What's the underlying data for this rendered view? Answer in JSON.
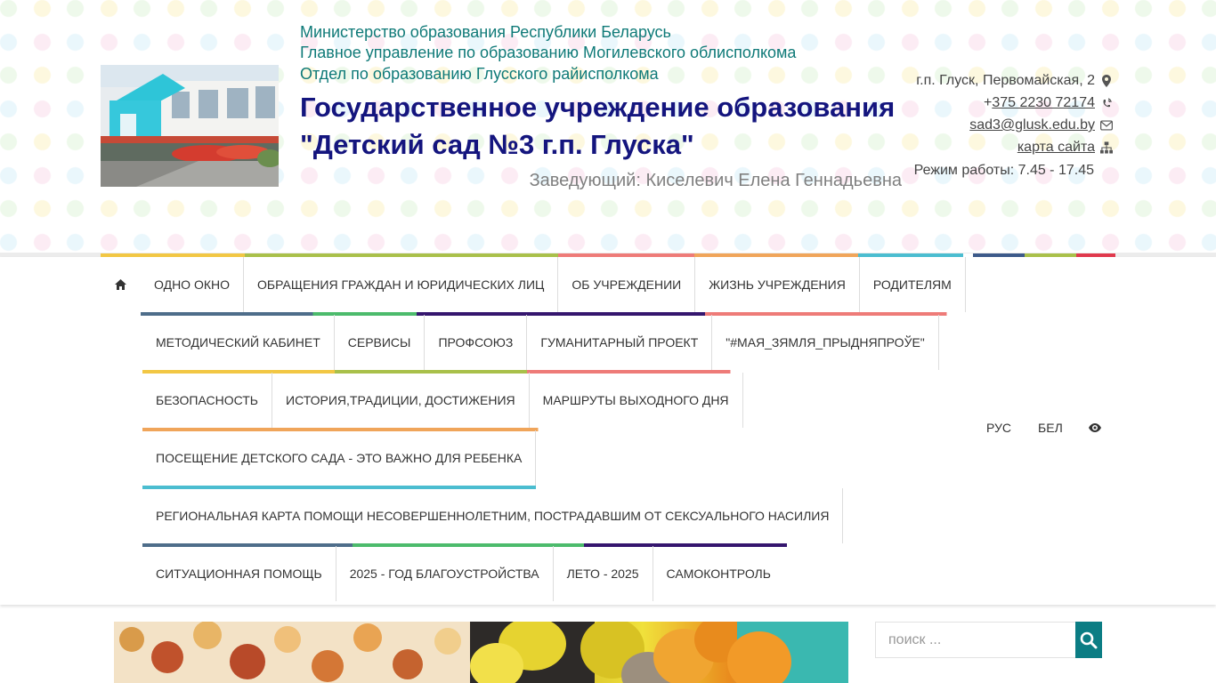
{
  "header": {
    "ministry_lines": [
      "Министерство образования Республики Беларусь",
      "Главное управление по образованию Могилевского облисполкома",
      "Отдел по образованию Глусского райисполкома"
    ],
    "title_line1": "Государственное учреждение образования",
    "title_line2": "\"Детский сад №3 г.п. Глуска\"",
    "director": "Заведующий: Киселевич Елена Геннадьевна",
    "contacts": {
      "address": "г.п. Глуск, Первомайская, 2",
      "phone_prefix": "+",
      "phone": "375 2230 72174",
      "email": "sad3@glusk.edu.by",
      "sitemap": "карта сайта",
      "hours": "Режим работы: 7.45 - 17.45"
    }
  },
  "nav": {
    "rows": [
      [
        "ОДНО ОКНО",
        "ОБРАЩЕНИЯ ГРАЖДАН И ЮРИДИЧЕСКИХ ЛИЦ",
        "ОБ УЧРЕЖДЕНИИ",
        "ЖИЗНЬ УЧРЕЖДЕНИЯ",
        "РОДИТЕЛЯМ"
      ],
      [
        "МЕТОДИЧЕСКИЙ КАБИНЕТ",
        "СЕРВИСЫ",
        "ПРОФСОЮЗ",
        "ГУМАНИТАРНЫЙ ПРОЕКТ",
        "\"#МАЯ_ЗЯМЛЯ_ПРЫДНЯПРОЎЕ\""
      ],
      [
        "БЕЗОПАСНОСТЬ",
        "ИСТОРИЯ,ТРАДИЦИИ, ДОСТИЖЕНИЯ",
        "МАРШРУТЫ ВЫХОДНОГО ДНЯ"
      ],
      [
        "ПОСЕЩЕНИЕ ДЕТСКОГО САДА - ЭТО ВАЖНО ДЛЯ РЕБЕНКА"
      ],
      [
        "РЕГИОНАЛЬНАЯ КАРТА ПОМОЩИ НЕСОВЕРШЕННОЛЕТНИМ, ПОСТРАДАВШИМ ОТ СЕКСУАЛЬНОГО НАСИЛИЯ"
      ],
      [
        "СИТУАЦИОННАЯ ПОМОЩЬ",
        "2025 - ГОД БЛАГОУСТРОЙСТВА",
        "ЛЕТО - 2025",
        "САМОКОНТРОЛЬ"
      ]
    ],
    "lang_ru": "РУС",
    "lang_by": "БЕЛ"
  },
  "search": {
    "placeholder": "поиск ..."
  },
  "colors": {
    "ministry_text": "#0f7a78",
    "title_text": "#14157e",
    "search_button": "#0b7d84",
    "yellow": "#f2c744",
    "green": "#a9c04a",
    "salmon": "#ee7b78",
    "orange": "#f0a55a",
    "teal": "#4bbdd0",
    "navy": "#3d5a8a",
    "red": "#e0394d",
    "slate": "#4e6d8a",
    "grass": "#4cbb6c",
    "indigo": "#35166e",
    "pink": "#ee7b78"
  }
}
